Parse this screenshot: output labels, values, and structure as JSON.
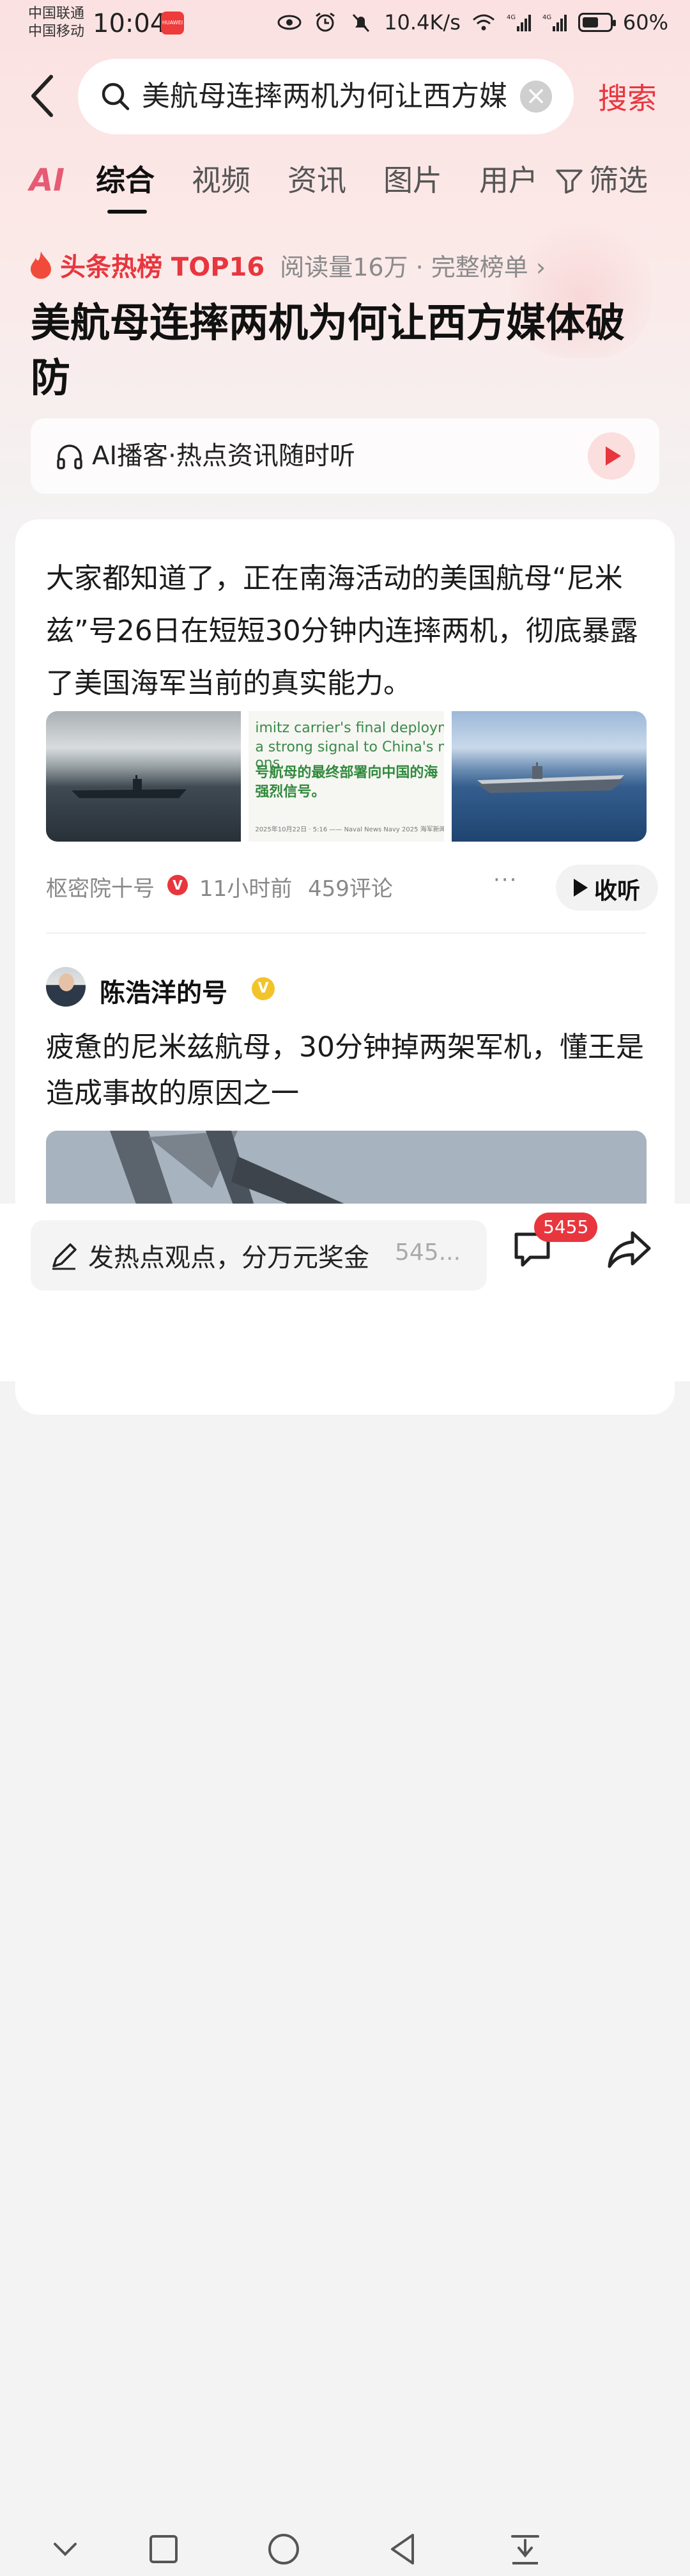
{
  "status_bar": {
    "carrier_line1": "中国联通",
    "carrier_line2": "中国移动",
    "time": "10:04",
    "network_speed": "10.4K/s",
    "battery": "60%",
    "battery_level": 0.6,
    "icons": [
      "eye-icon",
      "alarm-icon",
      "mute-icon",
      "wifi-icon",
      "4g-signal-icon",
      "4g-signal-icon",
      "battery-icon"
    ]
  },
  "search": {
    "query": "美航母连摔两机为何让西方媒",
    "submit_label": "搜索"
  },
  "tabs": {
    "ai": "AI",
    "items": [
      "综合",
      "视频",
      "资讯",
      "图片",
      "用户"
    ],
    "active": "综合",
    "filter": "筛选"
  },
  "hot": {
    "tag": "头条热榜 TOP16",
    "meta": "阅读量16万 · 完整榜单 ›",
    "title": "美航母连摔两机为何让西方媒体破防"
  },
  "podcast": {
    "label": "AI播客·热点资讯随时听"
  },
  "article1": {
    "text": "大家都知道了，正在南海活动的美国航母“尼米兹”号26日在短短30分钟内连摔两机，彻底暴露了美国海军当前的真实能力。",
    "thumb2": {
      "line1": "imitz carrier's final deployme",
      "line2": "a strong signal to China's ma",
      "line2b": "ons.",
      "line3": "号航母的最终部署向中国的海",
      "line4": "强烈信号。",
      "line5": "2025年10月22日 · 5:16  —— Naval News Navy 2025 海军新闻 海军2025"
    },
    "author": "枢密院十号",
    "verified": "V",
    "time": "11小时前",
    "comments": "459评论",
    "more": "···",
    "listen": "收听"
  },
  "article2": {
    "author": "陈浩洋的号",
    "verified": "V",
    "text": "疲惫的尼米兹航母，30分钟掉两架军机，懂王是造成事故的原因之一"
  },
  "bottom": {
    "comment_placeholder": "发热点观点，分万元奖金",
    "comment_count_inline": "545...",
    "comment_badge": "5455"
  },
  "colors": {
    "accent": "#e8363e",
    "gold_verified": "#f3c32b"
  }
}
